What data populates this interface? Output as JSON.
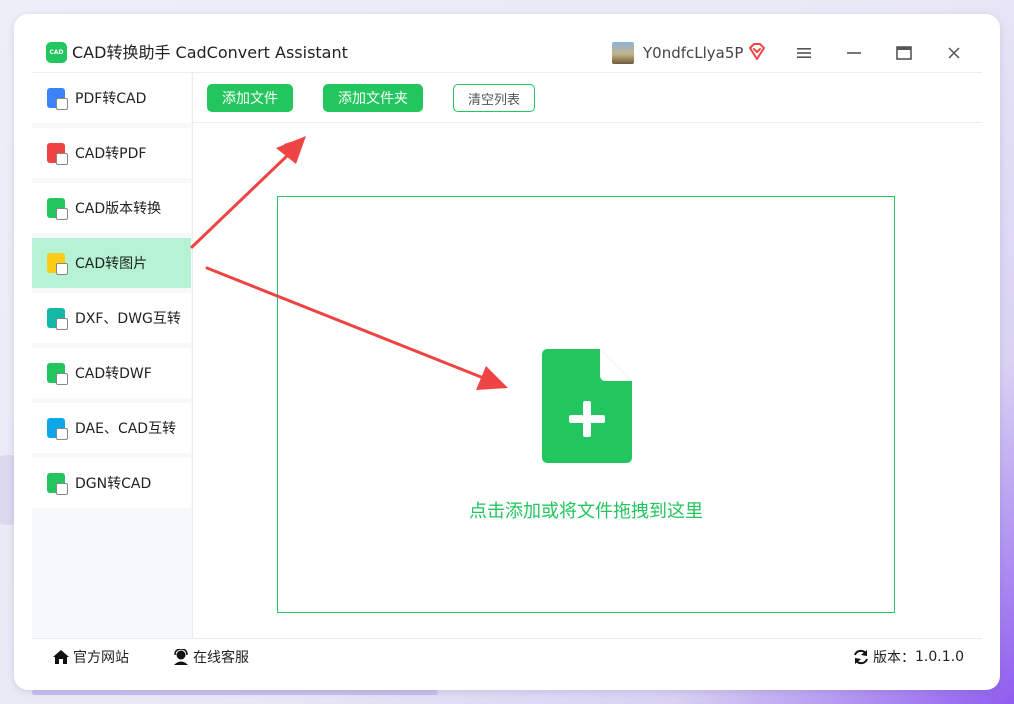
{
  "app": {
    "logo_text": "CAD",
    "title": "CAD转换助手 CadConvert Assistant",
    "username": "Y0ndfcLlya5P"
  },
  "sidebar": {
    "items": [
      {
        "label": "PDF转CAD",
        "color": "#3b82f6",
        "active": false
      },
      {
        "label": "CAD转PDF",
        "color": "#ef4444",
        "active": false
      },
      {
        "label": "CAD版本转换",
        "color": "#22c55e",
        "active": false
      },
      {
        "label": "CAD转图片",
        "color": "#facc15",
        "active": true
      },
      {
        "label": "DXF、DWG互转",
        "color": "#14b8a6",
        "active": false
      },
      {
        "label": "CAD转DWF",
        "color": "#22c55e",
        "active": false
      },
      {
        "label": "DAE、CAD互转",
        "color": "#0ea5e9",
        "active": false
      },
      {
        "label": "DGN转CAD",
        "color": "#22c55e",
        "active": false
      }
    ]
  },
  "toolbar": {
    "add_file": "添加文件",
    "add_folder": "添加文件夹",
    "clear_list": "清空列表"
  },
  "dropzone": {
    "hint": "点击添加或将文件拖拽到这里"
  },
  "footer": {
    "website": "官方网站",
    "support": "在线客服",
    "version_label": "版本：",
    "version": "1.0.1.0"
  },
  "colors": {
    "accent": "#22c55e",
    "active_bg": "#b5f3d4",
    "arrow": "#ef4444"
  }
}
